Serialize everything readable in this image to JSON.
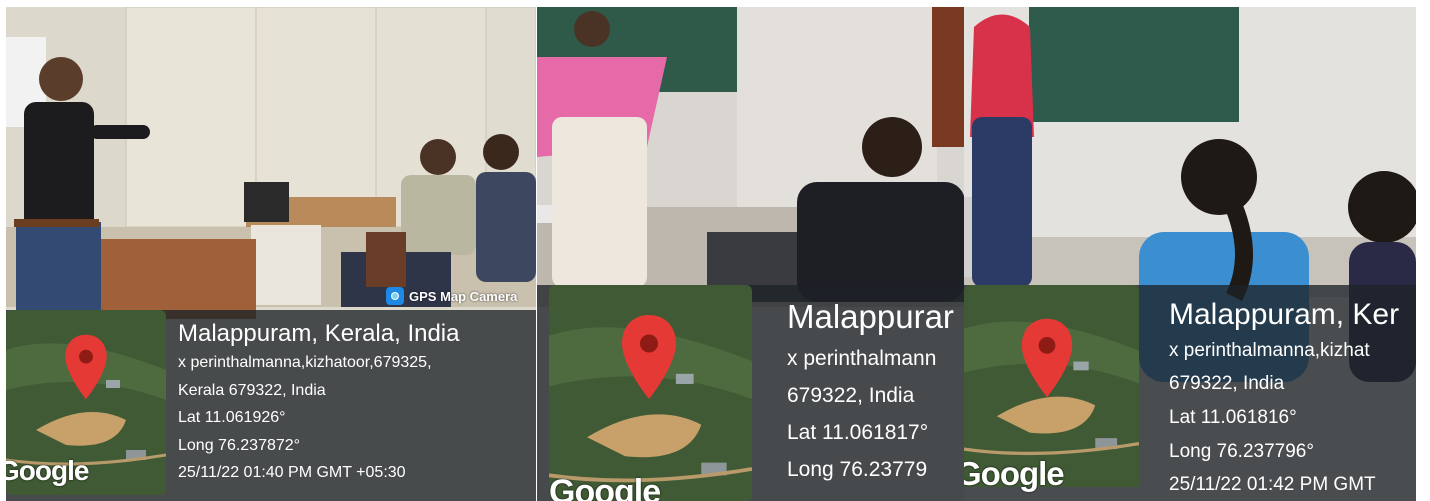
{
  "photos": [
    {
      "gps_badge": "GPS Map Camera",
      "google_logo": "Google",
      "location": "Malappuram, Kerala, India",
      "address_1": "x perinthalmanna,kizhatoor,679325,",
      "address_2": "Kerala 679322, India",
      "lat": "Lat 11.061926°",
      "long": "Long 76.237872°",
      "timestamp": "25/11/22 01:40 PM GMT +05:30"
    },
    {
      "google_logo": "Google",
      "location": "Malappurar",
      "address_1": "x perinthalmann",
      "address_2": "679322, India",
      "lat": "Lat 11.061817°",
      "long": "Long 76.23779"
    },
    {
      "google_logo": "Google",
      "location": "Malappuram, Ker",
      "address_1": "x perinthalmanna,kizhat",
      "address_2": "679322, India",
      "lat": "Lat 11.061816°",
      "long": "Long 76.237796°",
      "timestamp": "25/11/22 01:42 PM GMT"
    }
  ],
  "icons": [
    "location-pin-icon",
    "gps-camera-icon"
  ],
  "colors": {
    "pin": "#e53935",
    "pin_dot": "#8e1b14",
    "overlay": "#1e2228",
    "text": "#ffffff"
  }
}
